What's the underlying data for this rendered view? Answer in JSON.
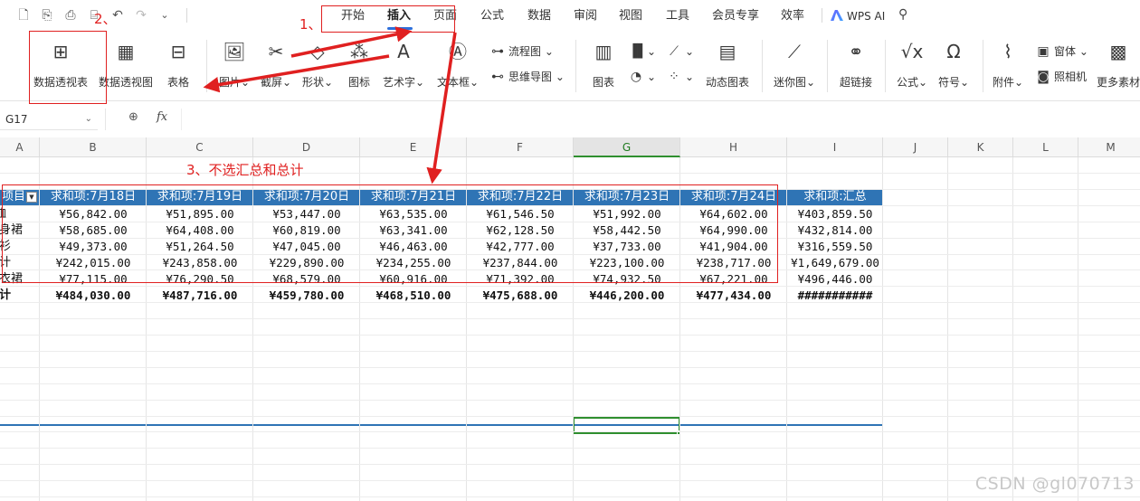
{
  "menu_tabs": [
    "开始",
    "插入",
    "页面",
    "公式",
    "数据",
    "审阅",
    "视图",
    "工具",
    "会员专享",
    "效率"
  ],
  "active_tab": "插入",
  "wps_ai_label": "WPS AI",
  "ribbon": {
    "pivot_table": "数据透视表",
    "pivot_chart": "数据透视图",
    "table": "表格",
    "picture": "图片",
    "screenshot": "截屏",
    "shape": "形状",
    "icon": "图标",
    "wordart": "艺术字",
    "textbox": "文本框",
    "flowchart": "流程图",
    "mindmap": "思维导图",
    "chart": "图表",
    "dynamic_chart": "动态图表",
    "sparkline": "迷你图",
    "hyperlink": "超链接",
    "formula": "公式",
    "symbol": "符号",
    "attachment": "附件",
    "window": "窗体",
    "camera": "照相机",
    "more": "更多素材"
  },
  "name_box": "G17",
  "fx_label": "fx",
  "columns": [
    "A",
    "B",
    "C",
    "D",
    "E",
    "F",
    "G",
    "H",
    "I",
    "J",
    "K",
    "L",
    "M"
  ],
  "selected_column": "G",
  "pivot": {
    "row_header": "项目",
    "headers": [
      "求和项:7月18日",
      "求和项:7月19日",
      "求和项:7月20日",
      "求和项:7月21日",
      "求和项:7月22日",
      "求和项:7月23日",
      "求和项:7月24日",
      "求和项:汇总"
    ],
    "rows": [
      {
        "label": "T恤",
        "values": [
          "¥56,842.00",
          "¥51,895.00",
          "¥53,447.00",
          "¥63,535.00",
          "¥61,546.50",
          "¥51,992.00",
          "¥64,602.00",
          "¥403,859.50"
        ]
      },
      {
        "label": "紧身裙",
        "values": [
          "¥58,685.00",
          "¥64,408.00",
          "¥60,819.00",
          "¥63,341.00",
          "¥62,128.50",
          "¥58,442.50",
          "¥64,990.00",
          "¥432,814.00"
        ]
      },
      {
        "label": "衬衫",
        "values": [
          "¥49,373.00",
          "¥51,264.50",
          "¥47,045.00",
          "¥46,463.00",
          "¥42,777.00",
          "¥37,733.00",
          "¥41,904.00",
          "¥316,559.50"
        ]
      },
      {
        "label": "合计",
        "values": [
          "¥242,015.00",
          "¥243,858.00",
          "¥229,890.00",
          "¥234,255.00",
          "¥237,844.00",
          "¥223,100.00",
          "¥238,717.00",
          "¥1,649,679.00"
        ]
      },
      {
        "label": "连衣裙",
        "values": [
          "¥77,115.00",
          "¥76,290.50",
          "¥68,579.00",
          "¥60,916.00",
          "¥71,392.00",
          "¥74,932.50",
          "¥67,221.00",
          "¥496,446.00"
        ]
      }
    ],
    "total_label": "总计",
    "total_values": [
      "¥484,030.00",
      "¥487,716.00",
      "¥459,780.00",
      "¥468,510.00",
      "¥475,688.00",
      "¥446,200.00",
      "¥477,434.00",
      "###########"
    ]
  },
  "annotations": {
    "step1": "1、",
    "step2": "2、",
    "step3": "3、不选汇总和总计"
  },
  "watermark": "CSDN @gl070713",
  "colors": {
    "header_blue": "#2f74b5",
    "annotation_red": "#e02020",
    "select_green": "#2f8f2f"
  }
}
